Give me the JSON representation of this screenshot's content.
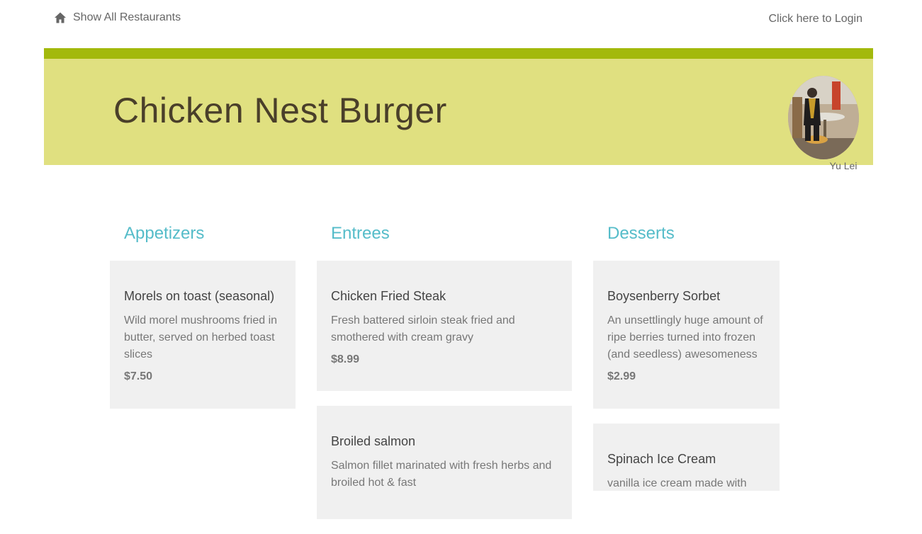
{
  "nav": {
    "home_label": "Show All Restaurants",
    "home_icon": "home-icon",
    "login_label": "Click here to Login"
  },
  "header": {
    "title": "Chicken Nest Burger",
    "owner_name": "Yu Lei",
    "accent_color": "#a3b90c",
    "banner_color": "#e0e080"
  },
  "menu": {
    "heading_color": "#55bcc9",
    "columns": [
      {
        "heading": "Appetizers",
        "items": [
          {
            "name": "Morels on toast (seasonal)",
            "description": "Wild morel mushrooms fried in butter, served on herbed toast slices",
            "price": "$7.50"
          }
        ]
      },
      {
        "heading": "Entrees",
        "items": [
          {
            "name": "Chicken Fried Steak",
            "description": "Fresh battered sirloin steak fried and smothered with cream gravy",
            "price": "$8.99"
          },
          {
            "name": "Broiled salmon",
            "description": "Salmon fillet marinated with fresh herbs and broiled hot & fast",
            "price": ""
          }
        ]
      },
      {
        "heading": "Desserts",
        "items": [
          {
            "name": "Boysenberry Sorbet",
            "description": "An unsettlingly huge amount of ripe berries turned into frozen (and seedless) awesomeness",
            "price": "$2.99"
          },
          {
            "name": "Spinach Ice Cream",
            "description": "vanilla ice cream made with",
            "price": ""
          }
        ]
      }
    ]
  }
}
